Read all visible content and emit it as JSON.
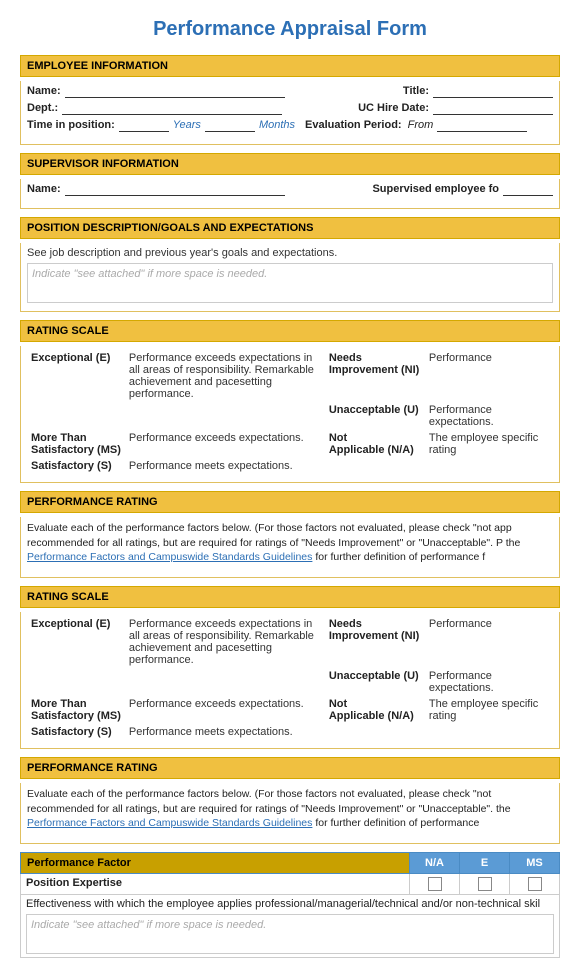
{
  "title": "Performance Appraisal Form",
  "employee_info": {
    "header": "EMPLOYEE INFORMATION",
    "name_label": "Name:",
    "title_label": "Title:",
    "dept_label": "Dept.:",
    "uc_hire_label": "UC Hire Date:",
    "time_label": "Time in position:",
    "years_label": "Years",
    "months_label": "Months",
    "eval_label": "Evaluation Period:",
    "from_label": "From"
  },
  "supervisor_info": {
    "header": "SUPERVISOR INFORMATION",
    "name_label": "Name:",
    "supervised_label": "Supervised employee fo"
  },
  "position_desc": {
    "header": "POSITION DESCRIPTION/GOALS AND EXPECTATIONS",
    "description": "See job description and previous year's goals and expectations.",
    "placeholder": "Indicate \"see attached\" if more space is needed."
  },
  "rating_scale": {
    "header": "RATING SCALE",
    "items": [
      {
        "label": "Exceptional (E)",
        "desc": "Performance exceeds expectations in all areas of responsibility. Remarkable achievement and pacesetting performance."
      },
      {
        "label": "More Than Satisfactory (MS)",
        "desc": "Performance exceeds expectations."
      },
      {
        "label": "Satisfactory (S)",
        "desc": "Performance meets expectations."
      },
      {
        "label": "Needs Improvement (NI)",
        "desc": "Performance"
      },
      {
        "label": "Unacceptable (U)",
        "desc": "Performance expectations."
      },
      {
        "label": "Not Applicable (N/A)",
        "desc": "The employee specific rating"
      }
    ]
  },
  "performance_rating": {
    "header": "PERFORMANCE RATING",
    "text1": "Evaluate each of the performance factors below. (For those factors not evaluated, please check \"not app recommended for all ratings, but are required for ratings of \"Needs Improvement\" or \"Unacceptable\". P the ",
    "link_text": "Performance Factors and Campuswide Standards Guidelines",
    "text2": " for further definition of performance f"
  },
  "rating_scale2": {
    "header": "RATING SCALE",
    "items": [
      {
        "label": "Exceptional (E)",
        "desc": "Performance exceeds expectations in all areas of responsibility. Remarkable achievement and pacesetting performance."
      },
      {
        "label": "More Than Satisfactory (MS)",
        "desc": "Performance exceeds expectations."
      },
      {
        "label": "Satisfactory (S)",
        "desc": "Performance meets expectations."
      },
      {
        "label": "Needs Improvement (NI)",
        "desc": "Performance"
      },
      {
        "label": "Unacceptable (U)",
        "desc": "Performance expectations."
      },
      {
        "label": "Not Applicable (N/A)",
        "desc": "The employee specific rating"
      }
    ]
  },
  "performance_rating2": {
    "header": "PERFORMANCE RATING",
    "text": "Evaluate each of the performance factors below. (For those factors not evaluated, please check \"not recommended for all ratings, but are required for ratings of \"Needs Improvement\" or \"Unacceptable\". the ",
    "link_text": "Performance Factors and Campuswide Standards Guidelines",
    "text2": " for further definition of performance"
  },
  "perf_table": {
    "col_factor": "Performance Factor",
    "col_na": "N/A",
    "col_e": "E",
    "col_ms": "MS",
    "rows": [
      {
        "name": "Position Expertise",
        "desc": "Effectiveness with which the employee applies professional/managerial/technical and/or non-technical skil",
        "placeholder": "Indicate \"see attached\" if more space is needed."
      }
    ]
  }
}
